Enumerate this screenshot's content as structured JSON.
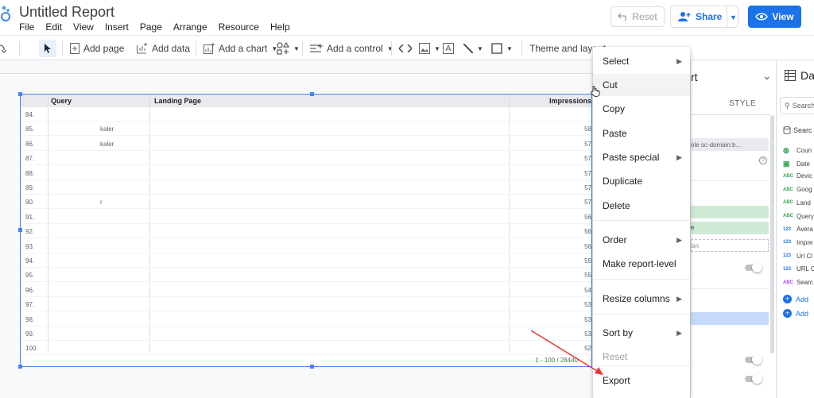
{
  "app": {
    "title": "Untitled Report",
    "menu": [
      "File",
      "Edit",
      "View",
      "Insert",
      "Page",
      "Arrange",
      "Resource",
      "Help"
    ]
  },
  "header": {
    "reset_label": "Reset",
    "share_label": "Share",
    "view_label": "View"
  },
  "toolbar": {
    "add_page": "Add page",
    "add_data": "Add data",
    "add_chart": "Add a chart",
    "add_control": "Add a control",
    "theme": "Theme and layout"
  },
  "table": {
    "headers": [
      "Query",
      "Landing Page",
      "Impressions"
    ],
    "rows": [
      {
        "num": "84.",
        "frag": "",
        "imp": ""
      },
      {
        "num": "85.",
        "frag": "kaler",
        "imp": "58"
      },
      {
        "num": "86.",
        "frag": "kaler",
        "imp": "57"
      },
      {
        "num": "87.",
        "frag": "",
        "imp": "57"
      },
      {
        "num": "88.",
        "frag": "",
        "imp": "57"
      },
      {
        "num": "89.",
        "frag": "",
        "imp": "57"
      },
      {
        "num": "90.",
        "frag": "r",
        "imp": "57"
      },
      {
        "num": "91.",
        "frag": "",
        "imp": "56"
      },
      {
        "num": "92.",
        "frag": "",
        "imp": "56"
      },
      {
        "num": "93.",
        "frag": "",
        "imp": "56"
      },
      {
        "num": "94.",
        "frag": "",
        "imp": "55"
      },
      {
        "num": "95.",
        "frag": "",
        "imp": "55"
      },
      {
        "num": "96.",
        "frag": "",
        "imp": "54"
      },
      {
        "num": "97.",
        "frag": "",
        "imp": "53"
      },
      {
        "num": "98.",
        "frag": "",
        "imp": "53"
      },
      {
        "num": "99.",
        "frag": "",
        "imp": "53"
      },
      {
        "num": "100.",
        "frag": "",
        "imp": "52"
      }
    ],
    "pagination": "1 - 100 / 28440"
  },
  "context_menu": {
    "select": "Select",
    "cut": "Cut",
    "copy": "Copy",
    "paste": "Paste",
    "paste_special": "Paste special",
    "duplicate": "Duplicate",
    "delete": "Delete",
    "order": "Order",
    "make_report_level": "Make report-level",
    "resize_columns": "Resize columns",
    "sort_by": "Sort by",
    "reset": "Reset",
    "export": "Export"
  },
  "properties_panel": {
    "title_fragment": "rt",
    "style_tab": "STYLE",
    "source_fragment": "ole sc-domain:b...",
    "dim_fragment": "e",
    "metric_fragment": "on"
  },
  "data_panel": {
    "title_fragment": "Da",
    "search_placeholder": "Search",
    "source_fragment": "Searc",
    "fields": [
      {
        "type": "geo",
        "name": "Coun"
      },
      {
        "type": "date",
        "name": "Date"
      },
      {
        "type": "ABC",
        "name": "Devic"
      },
      {
        "type": "ABC",
        "name": "Goog"
      },
      {
        "type": "ABC",
        "name": "Land"
      },
      {
        "type": "ABC",
        "name": "Query"
      },
      {
        "type": "123",
        "name": "Avera"
      },
      {
        "type": "123",
        "name": "Impre"
      },
      {
        "type": "123",
        "name": "Url Cl"
      },
      {
        "type": "123",
        "name": "URL C"
      },
      {
        "type": "ABC",
        "name": "Searc"
      }
    ],
    "add_1": "Add",
    "add_2": "Add"
  },
  "colors": {
    "accent": "#1a73e8",
    "selection": "#4285f4",
    "green_chip": "#ceead6",
    "blue_chip": "#c6dafc",
    "arrow": "#e53935"
  }
}
